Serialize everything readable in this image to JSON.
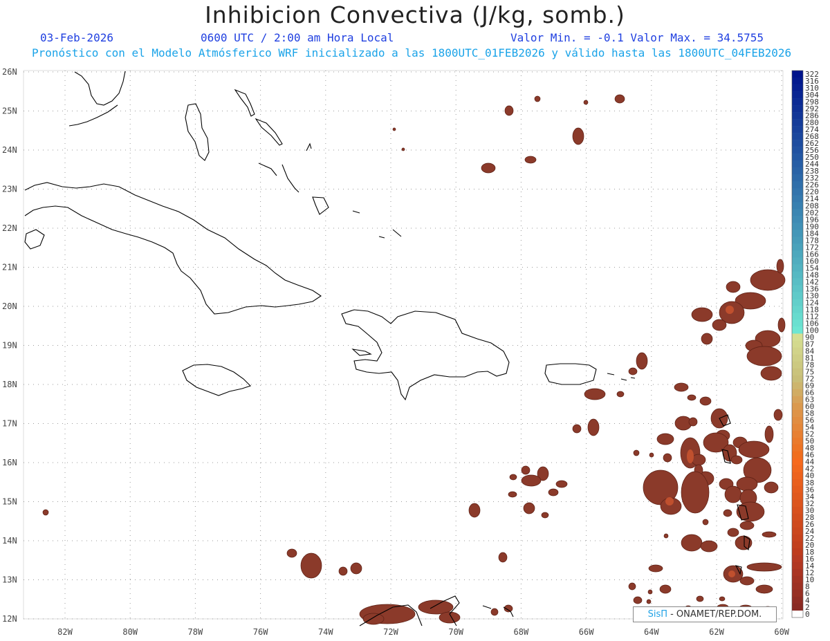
{
  "header": {
    "title": "Inhibicion Convectiva (J/kg, somb.)",
    "date": "03-Feb-2026",
    "time": "0600 UTC / 2:00 am Hora Local",
    "range": "Valor Min. = -0.1  Valor Max. = 34.5755",
    "description": "Pronóstico con el Modelo Atmósferico WRF inicializado a las 1800UTC_01FEB2026 y válido hasta las  1800UTC_04FEB2026"
  },
  "colors": {
    "header_blue": "#1f3fe0",
    "header_cyan": "#1aa3e8",
    "field": "#8b3a2a",
    "field_edge": "#5a1f14",
    "field_hot": "#c0502e"
  },
  "axes": {
    "lat_labels": [
      "26N",
      "25N",
      "24N",
      "23N",
      "22N",
      "21N",
      "20N",
      "19N",
      "18N",
      "17N",
      "16N",
      "15N",
      "14N",
      "13N",
      "12N"
    ],
    "lon_labels": [
      "82W",
      "80W",
      "78W",
      "76W",
      "74W",
      "72W",
      "70W",
      "68W",
      "66W",
      "64W",
      "62W",
      "60W"
    ]
  },
  "colorbar": {
    "labels": [
      "322",
      "316",
      "310",
      "304",
      "298",
      "292",
      "286",
      "280",
      "274",
      "268",
      "262",
      "256",
      "250",
      "244",
      "238",
      "232",
      "226",
      "220",
      "214",
      "208",
      "202",
      "196",
      "190",
      "184",
      "178",
      "172",
      "166",
      "160",
      "154",
      "148",
      "142",
      "136",
      "130",
      "124",
      "118",
      "112",
      "106",
      "100",
      "90",
      "87",
      "84",
      "81",
      "78",
      "75",
      "72",
      "69",
      "66",
      "63",
      "60",
      "58",
      "56",
      "54",
      "52",
      "50",
      "48",
      "46",
      "44",
      "42",
      "40",
      "38",
      "36",
      "34",
      "32",
      "30",
      "28",
      "26",
      "24",
      "22",
      "20",
      "18",
      "16",
      "14",
      "12",
      "10",
      "8",
      "6",
      "4",
      "2",
      "0"
    ]
  },
  "credit": {
    "logo": "SisΠ",
    "text": "- ONAMET/REP.DOM."
  }
}
